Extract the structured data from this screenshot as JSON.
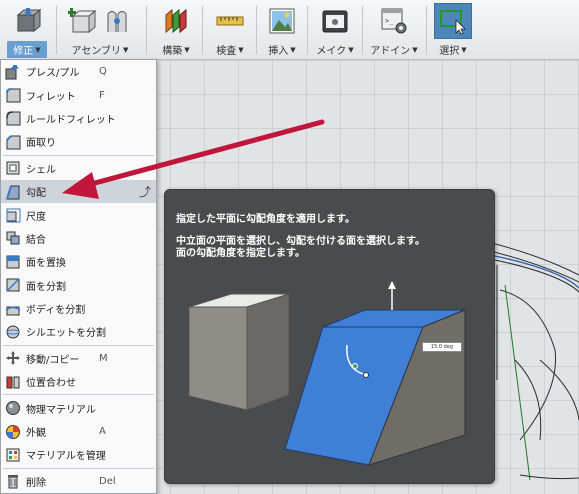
{
  "toolbar": {
    "groups": [
      {
        "label": "修正",
        "icon": "modify-icon",
        "active": true
      },
      {
        "label": "アセンブリ",
        "icon": "assembly-icon"
      },
      {
        "label": "構築",
        "icon": "construct-icon"
      },
      {
        "label": "検査",
        "icon": "inspect-icon"
      },
      {
        "label": "挿入",
        "icon": "insert-image-icon"
      },
      {
        "label": "メイク",
        "icon": "make-3d-print-icon"
      },
      {
        "label": "アドイン",
        "icon": "addins-script-icon"
      },
      {
        "label": "選択",
        "icon": "select-window-icon",
        "active": true
      }
    ]
  },
  "menu": {
    "items": [
      {
        "label": "プレス/プル",
        "shortcut": "Q",
        "icon": "press-pull-icon"
      },
      {
        "label": "フィレット",
        "shortcut": "F",
        "icon": "fillet-icon"
      },
      {
        "label": "ルールドフィレット",
        "shortcut": "",
        "icon": "rule-fillet-icon"
      },
      {
        "label": "面取り",
        "shortcut": "",
        "icon": "chamfer-icon"
      },
      {
        "label": "シェル",
        "shortcut": "",
        "icon": "shell-icon"
      },
      {
        "label": "勾配",
        "shortcut": "",
        "icon": "draft-icon",
        "active": true
      },
      {
        "label": "尺度",
        "shortcut": "",
        "icon": "scale-icon"
      },
      {
        "label": "結合",
        "shortcut": "",
        "icon": "combine-icon"
      },
      {
        "label": "面を置換",
        "shortcut": "",
        "icon": "replace-face-icon"
      },
      {
        "label": "面を分割",
        "shortcut": "",
        "icon": "split-face-icon"
      },
      {
        "label": "ボディを分割",
        "shortcut": "",
        "icon": "split-body-icon"
      },
      {
        "label": "シルエットを分割",
        "shortcut": "",
        "icon": "silhouette-split-icon"
      },
      {
        "label": "移動/コピー",
        "shortcut": "M",
        "icon": "move-copy-icon"
      },
      {
        "label": "位置合わせ",
        "shortcut": "",
        "icon": "align-icon"
      },
      {
        "label": "物理マテリアル",
        "shortcut": "",
        "icon": "physical-material-icon"
      },
      {
        "label": "外観",
        "shortcut": "A",
        "icon": "appearance-icon"
      },
      {
        "label": "マテリアルを管理",
        "shortcut": "",
        "icon": "manage-materials-icon"
      },
      {
        "label": "削除",
        "shortcut": "Del",
        "icon": "delete-icon"
      }
    ]
  },
  "tooltip": {
    "title": "指定した平面に勾配角度を適用します。",
    "body_line1": "中立面の平面を選択し、勾配を付ける面を選択します。",
    "body_line2": "面の勾配角度を指定します。",
    "angle_value": "15.0 deg"
  },
  "colors": {
    "accent_blue": "#4f86b8",
    "menu_active": "#cfd4da",
    "arrow_red": "#c0163c",
    "tooltip_bg": "#4a4b4d",
    "model_blue": "#3f7fd6"
  }
}
